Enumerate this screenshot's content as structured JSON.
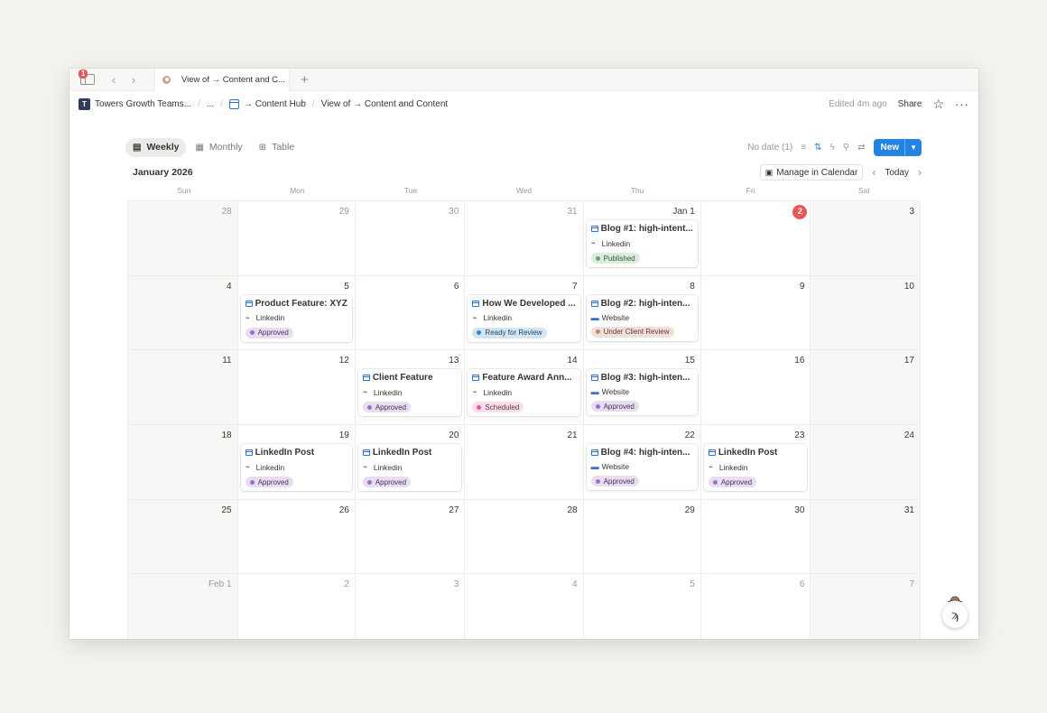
{
  "tabbar": {
    "notifications": "1",
    "tab_title": "View of → Content and C...",
    "new_tab": "+"
  },
  "breadcrumb": {
    "workspace_initial": "T",
    "workspace": "Towers Growth Teams...",
    "ellipsis": "...",
    "hub": "→ Content Hub",
    "view": "View of → Content and Content"
  },
  "topbar": {
    "edited": "Edited 4m ago",
    "share": "Share"
  },
  "views": {
    "tabs": [
      {
        "label": "Weekly",
        "icon": "calendar-week-icon",
        "active": true
      },
      {
        "label": "Monthly",
        "icon": "calendar-icon",
        "active": false
      },
      {
        "label": "Table",
        "icon": "table-icon",
        "active": false
      }
    ],
    "no_date": "No date (1)",
    "new_label": "New"
  },
  "header": {
    "month": "January 2026",
    "manage": "Manage in Calendar",
    "today": "Today"
  },
  "weekdays": [
    "Sun",
    "Mon",
    "Tue",
    "Wed",
    "Thu",
    "Fri",
    "Sat"
  ],
  "weeks": [
    [
      {
        "day": "28",
        "muted": true
      },
      {
        "day": "29",
        "muted": true
      },
      {
        "day": "30",
        "muted": true
      },
      {
        "day": "31",
        "muted": true
      },
      {
        "day": "Jan 1",
        "card": {
          "title": "Blog #1: high-intent...",
          "channel": "Linkedin",
          "channel_icon": "link-icon",
          "status": "Published",
          "status_class": "published"
        }
      },
      {
        "day": "2",
        "today": true
      },
      {
        "day": "3"
      }
    ],
    [
      {
        "day": "4"
      },
      {
        "day": "5",
        "card": {
          "title": "Product Feature: XYZ",
          "channel": "Linkedin",
          "channel_icon": "link-icon",
          "status": "Approved",
          "status_class": "approved"
        }
      },
      {
        "day": "6"
      },
      {
        "day": "7",
        "card": {
          "title": "How We Developed ...",
          "channel": "Linkedin",
          "channel_icon": "link-icon",
          "status": "Ready for Review",
          "status_class": "review"
        }
      },
      {
        "day": "8",
        "card": {
          "title": "Blog #2: high-inten...",
          "channel": "Website",
          "channel_icon": "monitor-icon",
          "status": "Under Client Review",
          "status_class": "client"
        }
      },
      {
        "day": "9"
      },
      {
        "day": "10"
      }
    ],
    [
      {
        "day": "11"
      },
      {
        "day": "12"
      },
      {
        "day": "13",
        "card": {
          "title": "Client Feature",
          "channel": "Linkedin",
          "channel_icon": "link-icon",
          "status": "Approved",
          "status_class": "approved"
        }
      },
      {
        "day": "14",
        "card": {
          "title": "Feature Award Ann...",
          "channel": "Linkedin",
          "channel_icon": "link-icon",
          "status": "Scheduled",
          "status_class": "scheduled"
        }
      },
      {
        "day": "15",
        "card": {
          "title": "Blog #3: high-inten...",
          "channel": "Website",
          "channel_icon": "monitor-icon",
          "status": "Approved",
          "status_class": "approved"
        }
      },
      {
        "day": "16"
      },
      {
        "day": "17"
      }
    ],
    [
      {
        "day": "18"
      },
      {
        "day": "19",
        "card": {
          "title": "LinkedIn Post",
          "channel": "Linkedin",
          "channel_icon": "link-icon",
          "status": "Approved",
          "status_class": "approved"
        }
      },
      {
        "day": "20",
        "card": {
          "title": "LinkedIn Post",
          "channel": "Linkedin",
          "channel_icon": "link-icon",
          "status": "Approved",
          "status_class": "approved"
        }
      },
      {
        "day": "21"
      },
      {
        "day": "22",
        "card": {
          "title": "Blog #4: high-inten...",
          "channel": "Website",
          "channel_icon": "monitor-icon",
          "status": "Approved",
          "status_class": "approved"
        }
      },
      {
        "day": "23",
        "card": {
          "title": "LinkedIn Post",
          "channel": "Linkedin",
          "channel_icon": "link-icon",
          "status": "Approved",
          "status_class": "approved"
        }
      },
      {
        "day": "24"
      }
    ],
    [
      {
        "day": "25"
      },
      {
        "day": "26"
      },
      {
        "day": "27"
      },
      {
        "day": "28"
      },
      {
        "day": "29"
      },
      {
        "day": "30"
      },
      {
        "day": "31"
      }
    ],
    [
      {
        "day": "Feb 1",
        "muted": true
      },
      {
        "day": "2",
        "muted": true
      },
      {
        "day": "3",
        "muted": true
      },
      {
        "day": "4",
        "muted": true
      },
      {
        "day": "5",
        "muted": true
      },
      {
        "day": "6",
        "muted": true
      },
      {
        "day": "7",
        "muted": true
      }
    ]
  ],
  "colors": {
    "accent": "#2383e2",
    "today": "#eb5757",
    "weekend_bg": "#f7f7f5"
  }
}
